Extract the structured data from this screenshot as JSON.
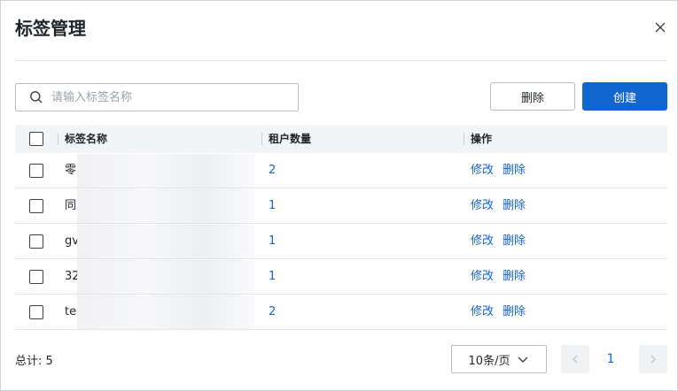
{
  "dialog": {
    "title": "标签管理",
    "close_icon": "close-icon"
  },
  "toolbar": {
    "search_placeholder": "请输入标签名称",
    "search_value": "",
    "delete_label": "删除",
    "create_label": "创建"
  },
  "table": {
    "columns": [
      "标签名称",
      "租户数量",
      "操作"
    ],
    "rows": [
      {
        "name": "零",
        "count": "2",
        "edit": "修改",
        "delete": "删除"
      },
      {
        "name": "同",
        "count": "1",
        "edit": "修改",
        "delete": "删除"
      },
      {
        "name": "gv",
        "count": "1",
        "edit": "修改",
        "delete": "删除"
      },
      {
        "name": "32",
        "count": "1",
        "edit": "修改",
        "delete": "删除"
      },
      {
        "name": "te",
        "count": "2",
        "edit": "修改",
        "delete": "删除"
      }
    ]
  },
  "footer": {
    "total": "总计: 5",
    "page_size": "10条/页",
    "current_page": "1"
  },
  "colors": {
    "primary": "#1366cf",
    "header_bg": "#f3f4f6",
    "border": "#b9bec5"
  }
}
